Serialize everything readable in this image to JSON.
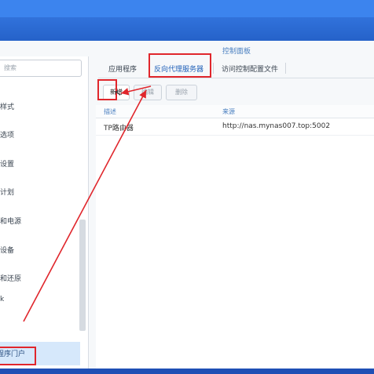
{
  "panel": {
    "title": "控制面板"
  },
  "sidebar": {
    "search_placeholder": "搜索",
    "items": [
      {
        "label": "样式"
      },
      {
        "label": "选项"
      },
      {
        "label": "设置"
      },
      {
        "label": "计划"
      },
      {
        "label": "和电源"
      },
      {
        "label": "设备"
      },
      {
        "label": "和还原"
      },
      {
        "label": "k"
      }
    ],
    "active_item": "程序门户"
  },
  "tabs": [
    {
      "label": "应用程序"
    },
    {
      "label": "反向代理服务器"
    },
    {
      "label": "访问控制配置文件"
    }
  ],
  "toolbar": {
    "new_label": "新增",
    "edit_label": "编辑",
    "delete_label": "删除"
  },
  "table": {
    "headers": [
      "描述",
      "来源"
    ],
    "rows": [
      {
        "description": "TP路由器",
        "source": "http://nas.mynas007.top:5002"
      }
    ]
  },
  "colors": {
    "accent": "#2463b9",
    "annotation": "#e0262c"
  }
}
